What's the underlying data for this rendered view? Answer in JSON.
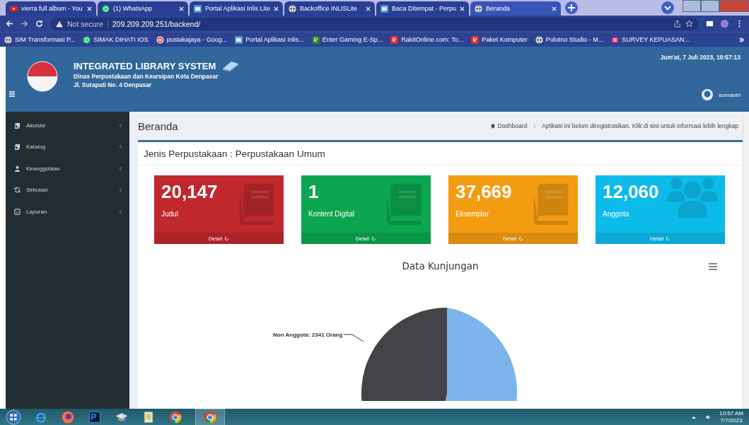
{
  "browser": {
    "tabs": [
      {
        "title": "vierra full album - You",
        "kind": "youtube",
        "selected": false
      },
      {
        "title": "(1) WhatsApp",
        "kind": "whatsapp",
        "selected": false
      },
      {
        "title": "Portal Aplikasi Inlis Lite",
        "kind": "page",
        "selected": false
      },
      {
        "title": "Backoffice INLISLite",
        "kind": "globe",
        "selected": false
      },
      {
        "title": "Baca Ditempat - Perpu",
        "kind": "page",
        "selected": false
      },
      {
        "title": "Beranda",
        "kind": "globe",
        "selected": true
      }
    ],
    "security": "Not secure",
    "url": "209.209.209.251/backend/",
    "bookmarks": [
      {
        "title": "SIM Transformasi P...",
        "kind": "globe"
      },
      {
        "title": "SIMAK DIHATI IOS",
        "kind": "whatsapp"
      },
      {
        "title": "pustakajaya - Goog...",
        "kind": "google"
      },
      {
        "title": "Portal Aplikasi Inlis...",
        "kind": "page"
      },
      {
        "title": "Enter Gaming E-Sp...",
        "kind": "game"
      },
      {
        "title": "RakitOnline.com: To...",
        "kind": "r"
      },
      {
        "title": "Paket Komputer",
        "kind": "r"
      },
      {
        "title": "Polotno Studio - M...",
        "kind": "globe"
      },
      {
        "title": "SURVEY KEPUASAN...",
        "kind": "list"
      }
    ]
  },
  "header": {
    "title": "INTEGRATED LIBRARY SYSTEM",
    "subtitle": "Dinas Perpustakaan dan Kearsipan Kota Denpasar",
    "address": "Jl. Surapati No. 4 Denpasar",
    "datetime": "Jum'at, 7 Juli 2023, 10:57:13",
    "user": "sumantri"
  },
  "sidebar": {
    "items": [
      {
        "label": "Akuisisi",
        "kind": "book"
      },
      {
        "label": "Katalog",
        "kind": "book"
      },
      {
        "label": "Keanggotaan",
        "kind": "user"
      },
      {
        "label": "Sirkulasi",
        "kind": "refresh"
      },
      {
        "label": "Laporan",
        "kind": "report"
      }
    ]
  },
  "content": {
    "title": "Beranda",
    "breadcrumb": "Dashboard",
    "notice": "Aplikasi ini belum diregistrasikan. Klik di sini untuk informasi lebih lengkap",
    "library_type": "Jenis Perpustakaan : Perpustakaan Umum",
    "cards": [
      {
        "value": "20,147",
        "label": "Judul",
        "link": "Detail",
        "color": "#c0282d",
        "kind": "book"
      },
      {
        "value": "1",
        "label": "Kontent Digital",
        "link": "Detail",
        "color": "#0ca650",
        "kind": "book"
      },
      {
        "value": "37,669",
        "label": "Eksemplar",
        "link": "Detail",
        "color": "#f39c12",
        "kind": "book"
      },
      {
        "value": "12,060",
        "label": "Anggota",
        "link": "Detail",
        "color": "#0dbbeb",
        "kind": "users"
      }
    ],
    "chart": {
      "title": "Data Kunjungan",
      "slice_label": "Non Anggota: 2341 Orang"
    }
  },
  "taskbar": {
    "time": "10:57 AM",
    "date": "7/7/2023"
  }
}
